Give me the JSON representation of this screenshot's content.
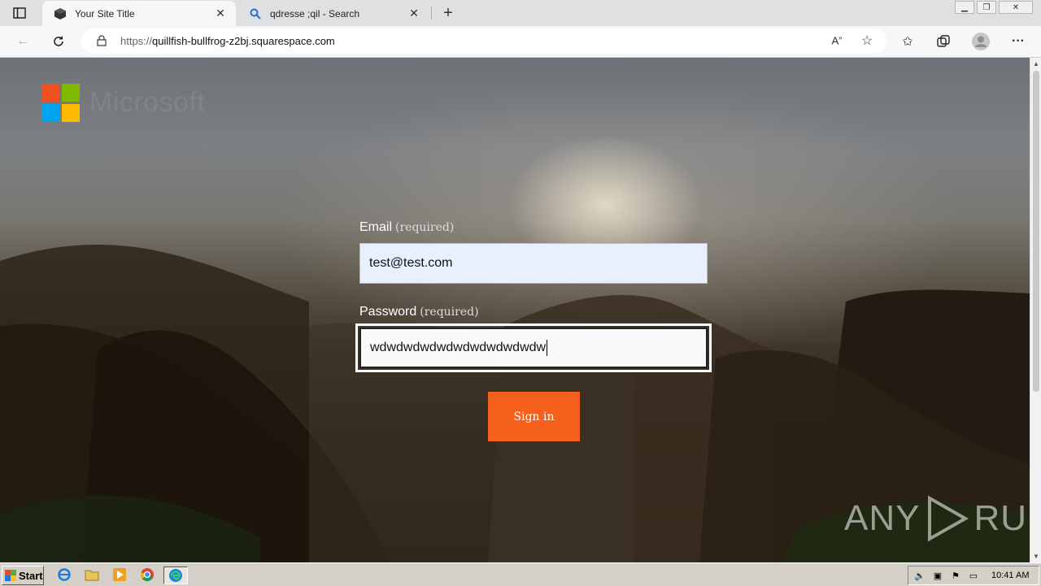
{
  "browser": {
    "tabs": [
      {
        "title": "Your Site Title",
        "active": true,
        "favicon": "cube-icon"
      },
      {
        "title": "qdresse ;qil - Search",
        "active": false,
        "favicon": "search-icon"
      }
    ],
    "url": {
      "scheme": "https://",
      "host": "quillfish-bullfrog-z2bj.squarespace.com"
    }
  },
  "page": {
    "logo_text": "Microsoft",
    "email": {
      "label": "Email",
      "required_note": "(required)",
      "value": "test@test.com"
    },
    "password": {
      "label": "Password",
      "required_note": "(required)",
      "value": "wdwdwdwdwdwdwdwdwdwdw"
    },
    "signin_label": "Sign in",
    "watermark": {
      "left": "ANY",
      "right": "RUN"
    }
  },
  "colors": {
    "accent": "#f5611d",
    "ms_red": "#f25022",
    "ms_green": "#7fba00",
    "ms_blue": "#00a4ef",
    "ms_yellow": "#ffb900"
  },
  "taskbar": {
    "start_label": "Start",
    "apps": [
      "ie-icon",
      "folder-icon",
      "media-player-icon",
      "chrome-icon",
      "edge-icon"
    ],
    "clock": "10:41 AM"
  }
}
